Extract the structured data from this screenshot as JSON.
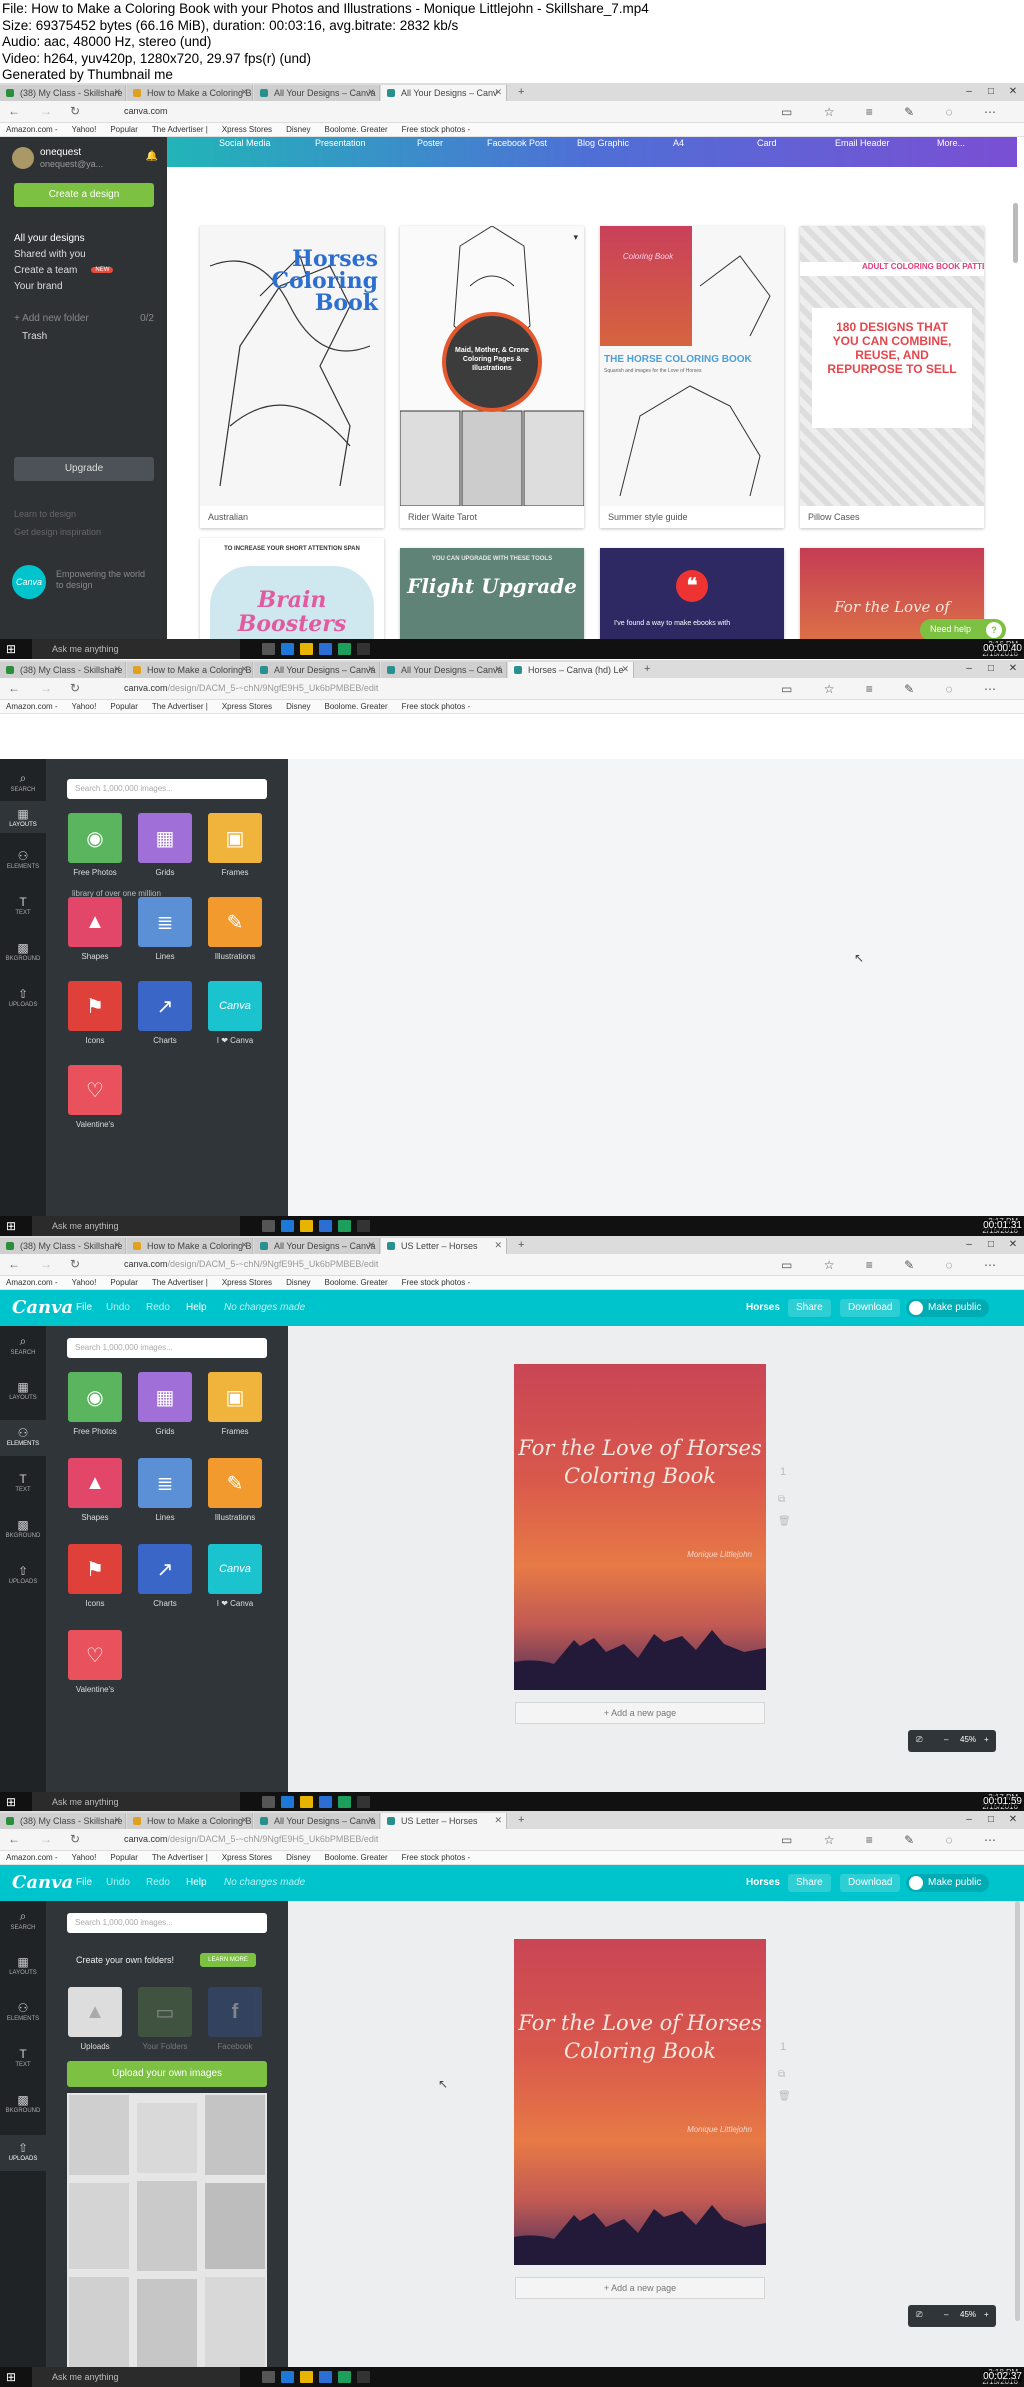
{
  "meta": {
    "lines": [
      "File: How to Make a Coloring Book with your Photos and Illustrations - Monique Littlejohn - Skillshare_7.mp4",
      "Size: 69375452 bytes (66.16 MiB), duration: 00:03:16, avg.bitrate: 2832 kb/s",
      "Audio: aac, 48000 Hz, stereo (und)",
      "Video: h264, yuv420p, 1280x720, 29.97 fps(r) (und)",
      "Generated by Thumbnail me"
    ]
  },
  "browser": {
    "tabs_frame1": [
      "(38) My Class - Skillshare",
      "How to Make a Coloring Bo",
      "All Your Designs – Canva",
      "All Your Designs – Canv"
    ],
    "tabs_frame2": [
      "(38) My Class - Skillshare",
      "How to Make a Coloring Bo",
      "All Your Designs – Canva",
      "All Your Designs – Canva",
      "Horses – Canva (hd) Le"
    ],
    "tabs_frame3": [
      "(38) My Class - Skillshare",
      "How to Make a Coloring Bo",
      "All Your Designs – Canva",
      "US Letter – Horses"
    ],
    "url_frame1": "canva.com",
    "url_domain": "canva.com",
    "url_path": "/design/DACM_5-~chN/9NgfE9H5_Uk6bPMBEB/edit",
    "bookmarks": [
      "Amazon.com -",
      "Yahoo!",
      "Popular",
      "The Advertiser |",
      "Xpress Stores",
      "Disney",
      "Boolome. Greater",
      "Free stock photos -"
    ],
    "new_tab": "+",
    "window_controls": [
      "–",
      "□",
      "✕"
    ],
    "nav": [
      "←",
      "→",
      "↻"
    ],
    "tools": "▭ ☆ ≡ ✎ ◌ ⋯"
  },
  "taskbar": {
    "start_icon": "⊞",
    "search_placeholder": "Ask me anything",
    "clocks": [
      {
        "time": "2:16 PM",
        "date": "2/15/2016",
        "stamp": "00:00:40"
      },
      {
        "time": "2:17 PM",
        "date": "2/15/2016",
        "stamp": "00:01:31"
      },
      {
        "time": "2:17 PM",
        "date": "2/15/2016",
        "stamp": "00:01:59"
      },
      {
        "time": "2:18 PM",
        "date": "2/15/2016",
        "stamp": "00:02:37"
      }
    ]
  },
  "frame1": {
    "user_name": "onequest",
    "user_email": "onequest@ya...",
    "create_design": "Create a design",
    "nav": [
      "All your designs",
      "Shared with you",
      "Create a team",
      "Your brand"
    ],
    "new_badge": "NEW",
    "add_folder": "+ Add new folder",
    "folder_count": "0/2",
    "trash": "Trash",
    "upgrade": "Upgrade",
    "links": [
      "Learn to design",
      "Get design inspiration"
    ],
    "tagline": "Empowering the world to design",
    "design_types": [
      "Social Media",
      "Presentation",
      "Poster",
      "Facebook Post",
      "Blog Graphic",
      "A4",
      "Card",
      "Email Header",
      "More..."
    ],
    "cards": [
      {
        "caption": "Australian",
        "title": "Horses Coloring Book"
      },
      {
        "caption": "Rider Waite Tarot",
        "title": "Maid, Mother, & Crone Coloring Pages & Illustrations"
      },
      {
        "caption": "Summer style guide",
        "title": "THE HORSE COLORING BOOK",
        "subtitle": "Coloring Book",
        "sub2": "Squarish and images for the Love of Horses"
      },
      {
        "caption": "Pillow Cases",
        "title": "ADULT COLORING BOOK PATTE",
        "subtitle": "180 DESIGNS THAT YOU CAN COMBINE, REUSE, AND REPURPOSE TO SELL"
      }
    ],
    "row2": [
      {
        "title": "TO INCREASE YOUR SHORT ATTENTION SPAN",
        "big": "Brain Boosters"
      },
      {
        "title": "YOU CAN UPGRADE WITH THESE TOOLS",
        "big": "Flight Upgrade"
      },
      {
        "title": "I've found a way to make ebooks with"
      },
      {
        "big": "For the Love of"
      }
    ],
    "need_help": "Need help",
    "need_help_icon": "?"
  },
  "editor": {
    "logo": "Canva",
    "menu": [
      "File",
      "Undo",
      "Redo",
      "Help"
    ],
    "saved": "No changes made",
    "doc_title": "Horses",
    "share": "Share",
    "download": "Download",
    "make_public": "Make public",
    "rail": [
      "SEARCH",
      "LAYOUTS",
      "ELEMENTS",
      "TEXT",
      "BKGROUND",
      "UPLOADS"
    ],
    "rail_icons": [
      "⌕",
      "▦",
      "⚇",
      "T",
      "▩",
      "⇧"
    ],
    "search_placeholder": "Search 1,000,000 images...",
    "tiles": [
      {
        "label": "Free Photos",
        "color": "#5ab55e",
        "icon": "◉"
      },
      {
        "label": "Grids",
        "color": "#a070d8",
        "icon": "▦"
      },
      {
        "label": "Frames",
        "color": "#f0b43c",
        "icon": "▣"
      },
      {
        "label": "Shapes",
        "color": "#e2476a",
        "icon": "▲"
      },
      {
        "label": "Lines",
        "color": "#5b8fd6",
        "icon": "≣"
      },
      {
        "label": "Illustrations",
        "color": "#f29a2e",
        "icon": "✎"
      },
      {
        "label": "Icons",
        "color": "#e0403a",
        "icon": "⚑"
      },
      {
        "label": "Charts",
        "color": "#3a66c8",
        "icon": "↗"
      },
      {
        "label": "I ❤ Canva",
        "color": "#1bc3cf",
        "icon": "Canva"
      },
      {
        "label": "Valentine's",
        "color": "#e9525c",
        "icon": "♡"
      }
    ],
    "ghost_text": "library of over one million",
    "page_title": "For the Love of Horses Coloring Book",
    "author": "Monique Littlejohn",
    "add_page": "+ Add a new page",
    "page_number": "1",
    "zoom_level": "45%",
    "zoom_minus": "–",
    "zoom_plus": "+",
    "zoom_icon": "⎚",
    "uploads_prompt": "Create your own folders!",
    "learn_more": "LEARN MORE",
    "upload_sources": [
      "Uploads",
      "Your Folders",
      "Facebook"
    ],
    "upload_btn": "Upload your own images"
  }
}
